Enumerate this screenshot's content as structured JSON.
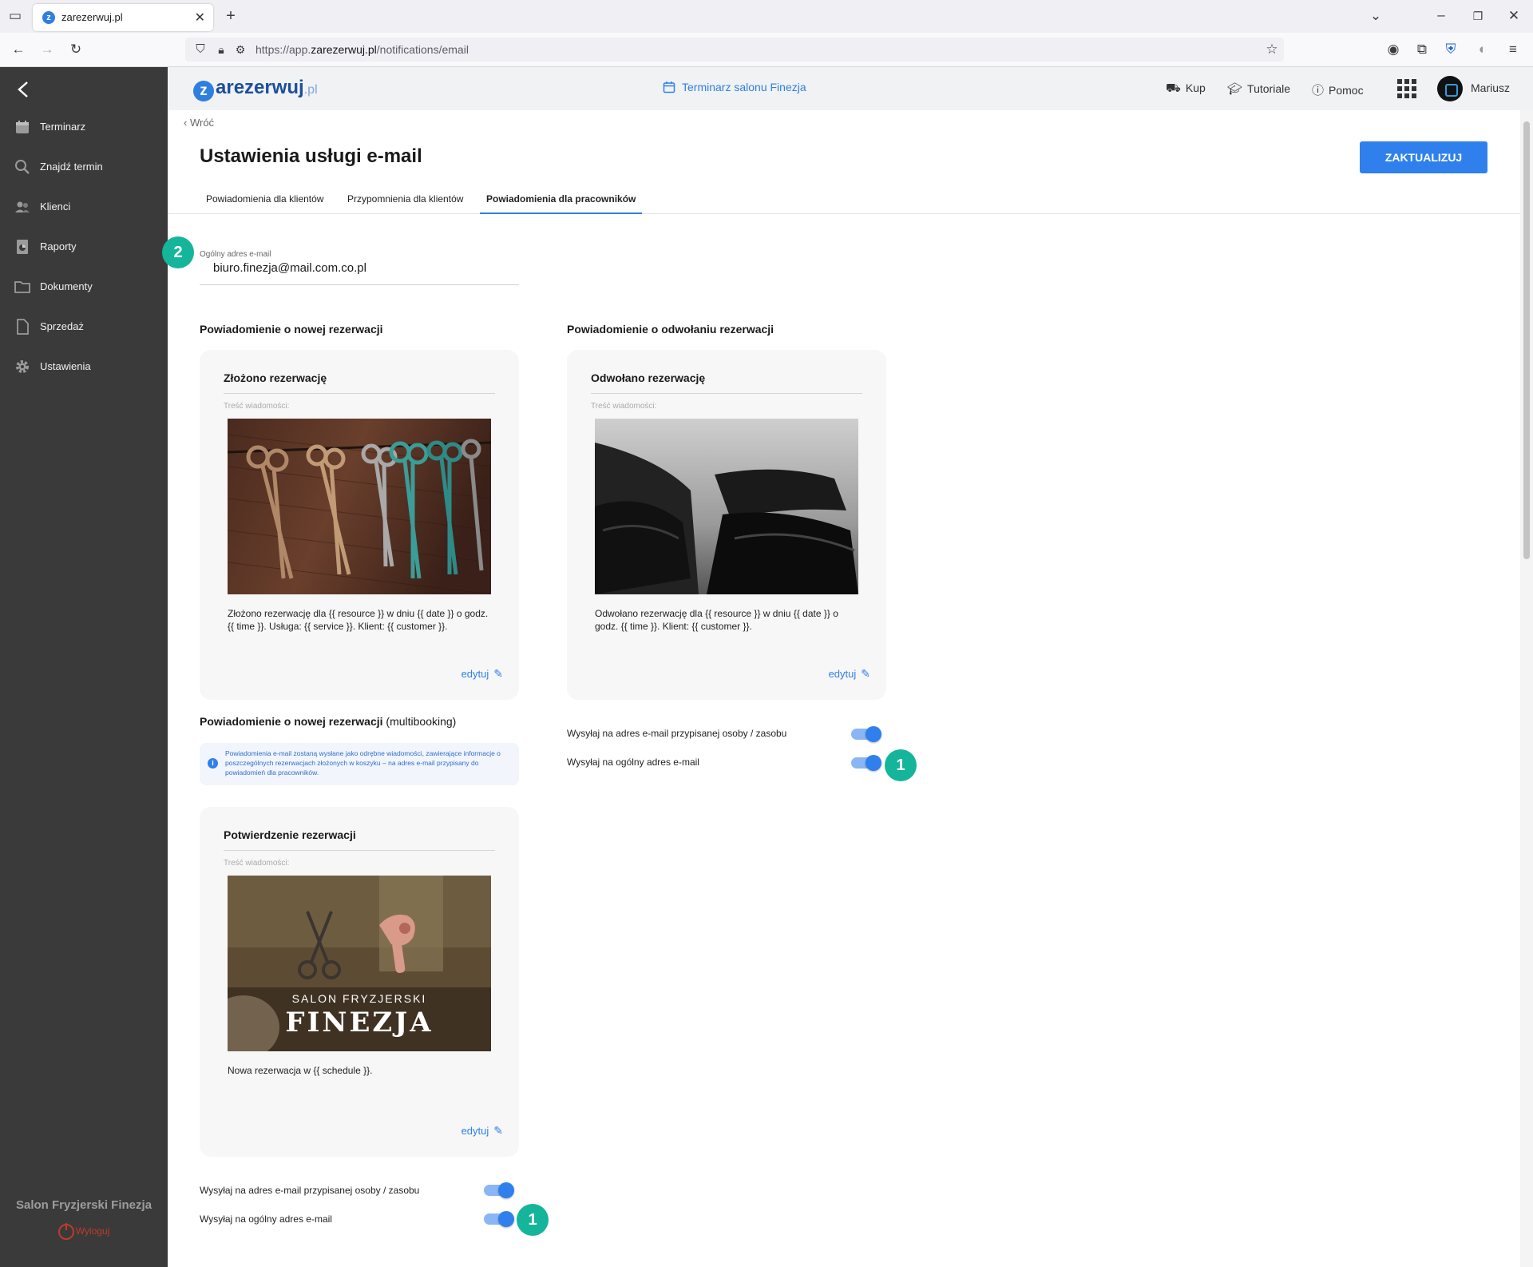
{
  "browser": {
    "tab_title": "zarezerwuj.pl",
    "url_prefix": "https://app.",
    "url_domain": "zarezerwuj.pl",
    "url_path": "/notifications/email"
  },
  "sidebar": {
    "items": [
      {
        "label": "Terminarz",
        "icon": "calendar-icon"
      },
      {
        "label": "Znajdź termin",
        "icon": "search-icon"
      },
      {
        "label": "Klienci",
        "icon": "users-icon"
      },
      {
        "label": "Raporty",
        "icon": "report-icon"
      },
      {
        "label": "Dokumenty",
        "icon": "folder-icon"
      },
      {
        "label": "Sprzedaż",
        "icon": "document-icon"
      },
      {
        "label": "Ustawienia",
        "icon": "gear-icon"
      }
    ],
    "salon_name": "Salon Fryzjerski Finezja",
    "logout_label": "Wyloguj"
  },
  "header": {
    "logo_main": "arezerwuj",
    "logo_tld": ".pl",
    "calendar_link": "Terminarz salonu Finezja",
    "links": {
      "buy": "Kup",
      "tutorials": "Tutoriale",
      "help": "Pomoc"
    },
    "user_name": "Mariusz"
  },
  "main": {
    "back_label": "Wróć",
    "title": "Ustawienia usługi e-mail",
    "update_button": "ZAKTUALIZUJ",
    "tabs": [
      {
        "label": "Powiadomienia dla klientów",
        "active": false
      },
      {
        "label": "Przypomnienia dla klientów",
        "active": false
      },
      {
        "label": "Powiadomienia dla pracowników",
        "active": true
      }
    ],
    "general_email": {
      "label": "Ogólny adres e-mail",
      "value": "biuro.finezja@mail.com.co.pl"
    },
    "new_booking": {
      "section_title": "Powiadomienie o nowej rezerwacji",
      "card_title": "Złożono rezerwację",
      "msg_label": "Treść wiadomości:",
      "text": "Złożono rezerwację dla {{ resource }} w dniu {{ date }} o godz. {{ time }}. Usługa: {{ service }}. Klient: {{ customer }}.",
      "edit_label": "edytuj"
    },
    "cancel_booking": {
      "section_title": "Powiadomienie o odwołaniu rezerwacji",
      "card_title": "Odwołano rezerwację",
      "msg_label": "Treść wiadomości:",
      "text": "Odwołano rezerwację dla {{ resource }} w dniu {{ date }} o godz. {{ time }}. Klient: {{ customer }}.",
      "edit_label": "edytuj",
      "toggle_assigned": {
        "label": "Wysyłaj na adres e-mail przypisanej osoby / zasobu",
        "on": true
      },
      "toggle_general": {
        "label": "Wysyłaj na ogólny adres e-mail",
        "on": true
      }
    },
    "multibooking": {
      "section_title": "Powiadomienie o nowej rezerwacji",
      "section_suffix": "(multibooking)",
      "info": "Powiadomienia e-mail zostaną wysłane jako odrębne wiadomości, zawierające informacje o poszczególnych rezerwacjach złożonych w koszyku – na adres e-mail przypisany do powiadomień dla pracowników.",
      "card_title": "Potwierdzenie rezerwacji",
      "msg_label": "Treść wiadomości:",
      "image_line1": "SALON FRYZJERSKI",
      "image_line2": "FINEZJA",
      "text": "Nowa rezerwacja w {{ schedule }}.",
      "edit_label": "edytuj",
      "toggle_assigned": {
        "label": "Wysyłaj na adres e-mail przypisanej osoby / zasobu",
        "on": true
      },
      "toggle_general": {
        "label": "Wysyłaj na ogólny adres e-mail",
        "on": true
      }
    },
    "badges": {
      "email": "2",
      "toggle": "1"
    }
  },
  "colors": {
    "accent": "#2f80ed",
    "sidebar": "#3a3a3a",
    "badge": "#15b59b",
    "logout": "#c0392b"
  }
}
